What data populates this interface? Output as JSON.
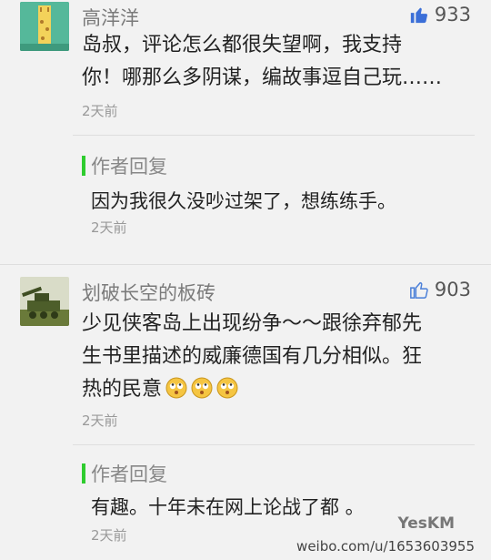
{
  "comments": [
    {
      "username": "高洋洋",
      "likes": "933",
      "text_lines": [
        "岛叔，评论怎么都很失望啊，我支持",
        "你！哪那么多阴谋，编故事逗自己玩……"
      ],
      "time": "2天前",
      "reply": {
        "label": "作者回复",
        "text": "因为我很久没吵过架了，想练练手。",
        "time": "2天前"
      },
      "like_icon": "thumb-up-filled-icon"
    },
    {
      "username": "划破长空的板砖",
      "likes": "903",
      "text_lines": [
        "少见侠客岛上出现纷争～～跟徐弃郁先",
        "生书里描述的威廉德国有几分相似。狂",
        "热的民意"
      ],
      "time": "2天前",
      "reply": {
        "label": "作者回复",
        "text": "有趣。十年未在网上论战了都 。",
        "time": "2天前"
      },
      "like_icon": "thumb-up-outline-icon"
    }
  ],
  "watermark": {
    "url": "weibo.com/u/1653603955",
    "logo": "YesKM"
  },
  "colors": {
    "reply_bar": "#2ecc2e",
    "like_active": "#3b6fd8",
    "like_inactive": "#4a7fd8"
  }
}
